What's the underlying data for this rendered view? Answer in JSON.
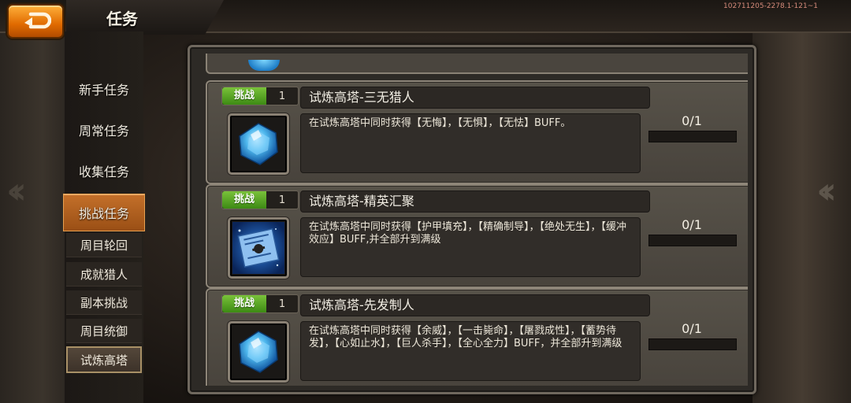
{
  "header": {
    "title": "任务",
    "build_info": "102711205-2278.1-121~1",
    "back_icon": "back-arrow-icon"
  },
  "sidebar": {
    "tabs": [
      {
        "label": "新手任务",
        "active": false
      },
      {
        "label": "周常任务",
        "active": false
      },
      {
        "label": "收集任务",
        "active": false
      },
      {
        "label": "挑战任务",
        "active": true
      }
    ],
    "subtabs": [
      {
        "label": "周目轮回",
        "active": false
      },
      {
        "label": "成就猎人",
        "active": false
      },
      {
        "label": "副本挑战",
        "active": false
      },
      {
        "label": "周目统御",
        "active": false
      },
      {
        "label": "试炼高塔",
        "active": true
      }
    ]
  },
  "tasks": [
    {
      "tag": "挑战",
      "tag_num": "1",
      "name": "试炼高塔-三无猎人",
      "description": "在试炼高塔中同时获得【无悔】，【无惧】，【无怯】BUFF。",
      "progress_text": "0/1",
      "progress": 0,
      "reward_icon": "blue-crystal-icon"
    },
    {
      "tag": "挑战",
      "tag_num": "1",
      "name": "试炼高塔-精英汇聚",
      "description": "在试炼高塔中同时获得【护甲填充】，【精确制导】，【绝处无生】，【缓冲效应】BUFF,并全部升到满级",
      "progress_text": "0/1",
      "progress": 0,
      "reward_icon": "blueprint-scroll-icon"
    },
    {
      "tag": "挑战",
      "tag_num": "1",
      "name": "试炼高塔-先发制人",
      "description": "在试炼高塔中同时获得【余威】，【一击毙命】，【屠戮成性】，【蓄势待发】，【心如止水】，【巨人杀手】，【全心全力】BUFF，并全部升到满级",
      "progress_text": "0/1",
      "progress": 0,
      "reward_icon": "blue-crystal-icon"
    }
  ],
  "colors": {
    "accent_orange": "#e06a00",
    "tag_green": "#5aa82a",
    "progress_fill": "#f0c050"
  }
}
